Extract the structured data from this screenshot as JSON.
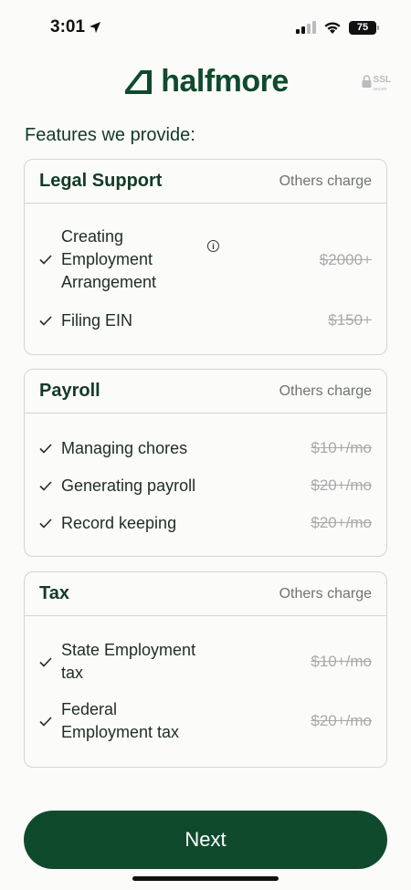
{
  "status": {
    "time": "3:01",
    "battery": "75"
  },
  "brand": {
    "name": "halfmore",
    "ssl": "SSL",
    "ssl_sub": "secure",
    "color": "#0f4a2c"
  },
  "page": {
    "heading": "Features we provide:"
  },
  "cards": [
    {
      "title": "Legal Support",
      "others_label": "Others charge",
      "items": [
        {
          "name": "Creating Employment Arrangement",
          "price": "$2000+",
          "has_info": true
        },
        {
          "name": "Filing EIN",
          "price": "$150+"
        }
      ]
    },
    {
      "title": "Payroll",
      "others_label": "Others charge",
      "items": [
        {
          "name": "Managing chores",
          "price": "$10+/mo"
        },
        {
          "name": "Generating payroll",
          "price": "$20+/mo"
        },
        {
          "name": "Record keeping",
          "price": "$20+/mo"
        }
      ]
    },
    {
      "title": "Tax",
      "others_label": "Others charge",
      "items": [
        {
          "name": "State Employment tax",
          "price": "$10+/mo"
        },
        {
          "name": "Federal Employment tax",
          "price": "$20+/mo"
        }
      ]
    }
  ],
  "footer": {
    "next_label": "Next"
  }
}
